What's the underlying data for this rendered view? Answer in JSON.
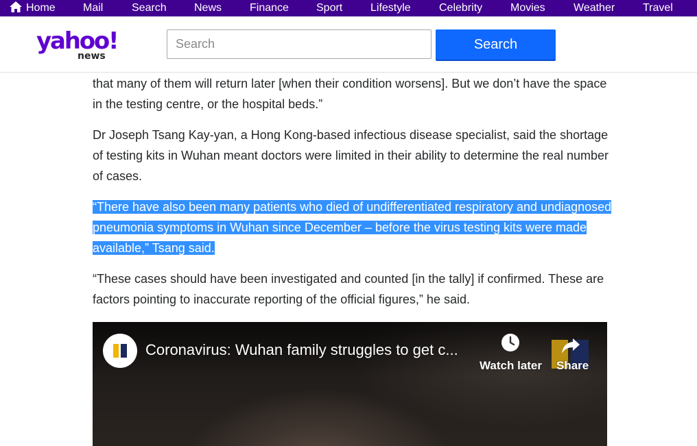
{
  "nav": {
    "items": [
      {
        "label": "Home",
        "icon": "home-icon"
      },
      {
        "label": "Mail"
      },
      {
        "label": "Search"
      },
      {
        "label": "News"
      },
      {
        "label": "Finance"
      },
      {
        "label": "Sport"
      },
      {
        "label": "Lifestyle"
      },
      {
        "label": "Celebrity"
      },
      {
        "label": "Movies"
      },
      {
        "label": "Weather"
      },
      {
        "label": "Travel"
      }
    ],
    "background": "#400090"
  },
  "header": {
    "logo_main": "yahoo!",
    "logo_sub": "news",
    "search_placeholder": "Search",
    "search_value": "",
    "search_button": "Search",
    "brand_color": "#5f01d1",
    "button_color": "#0f69ff"
  },
  "article": {
    "p1": "that many of them will return later [when their condition worsens]. But we don’t have the space in the testing centre, or the hospital beds.”",
    "p2": "Dr Joseph Tsang Kay-yan, a Hong Kong-based infectious disease specialist, said the shortage of testing kits in Wuhan meant doctors were limited in their ability to determine the real number of cases.",
    "p3_selected": "“There have also been many patients who died of undifferentiated respiratory and undiagnosed pneumonia symptoms in Wuhan since December – before the virus testing kits were made available,” Tsang said.",
    "p4": "“These cases should have been investigated and counted [in the tally] if confirmed. These are factors pointing to inaccurate reporting of the official figures,” he said.",
    "selection_color": "#3391ff"
  },
  "video": {
    "title": "Coronavirus: Wuhan family struggles to get c...",
    "watch_later": "Watch later",
    "share": "Share",
    "channel_icon": "channel-avatar-icon"
  }
}
